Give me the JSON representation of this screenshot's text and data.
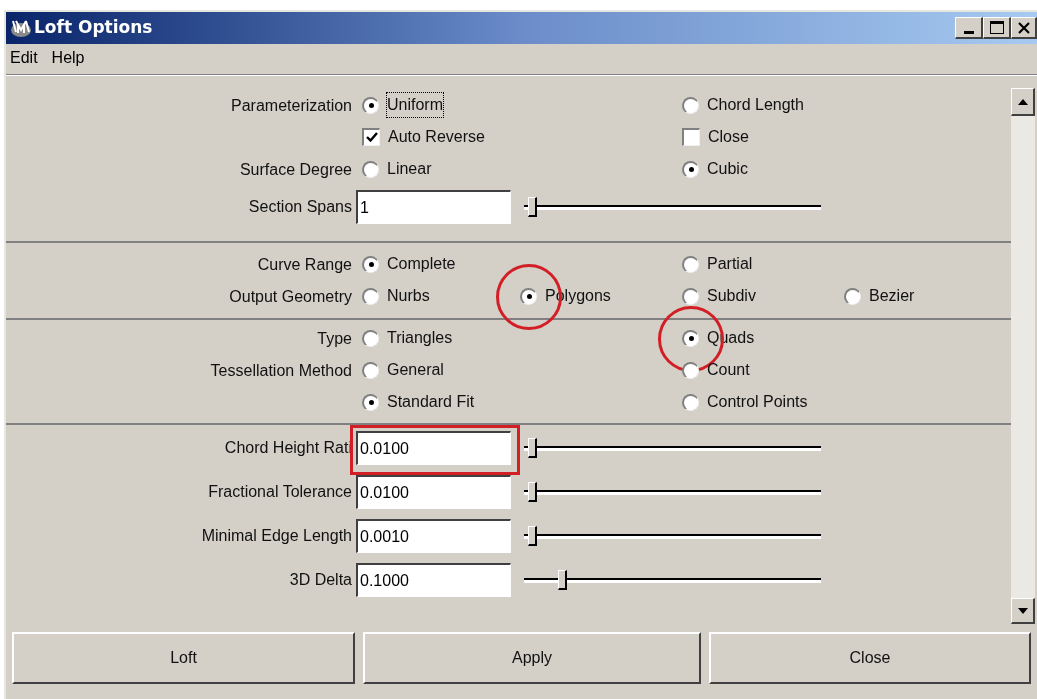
{
  "window": {
    "title": "Loft Options"
  },
  "menu": [
    "Edit",
    "Help"
  ],
  "sections": [
    {
      "rows": [
        {
          "kind": "radio",
          "label": "Parameterization",
          "options": [
            {
              "label": "Uniform",
              "selected": true,
              "focused": true,
              "circled": false
            },
            {
              "label": "Chord Length",
              "selected": false,
              "focused": false,
              "circled": false
            }
          ]
        },
        {
          "kind": "checkbox",
          "options": [
            {
              "label": "Auto Reverse",
              "checked": true
            },
            {
              "label": "Close",
              "checked": false
            }
          ]
        },
        {
          "kind": "radio",
          "label": "Surface Degree",
          "options": [
            {
              "label": "Linear",
              "selected": false,
              "focused": false,
              "circled": false
            },
            {
              "label": "Cubic",
              "selected": true,
              "focused": false,
              "circled": false
            }
          ]
        },
        {
          "kind": "slider",
          "label": "Section Spans",
          "value": "1",
          "level": 0.02,
          "boxed": false
        }
      ]
    },
    {
      "rows": [
        {
          "kind": "radio",
          "label": "Curve Range",
          "options": [
            {
              "label": "Complete",
              "selected": true,
              "focused": false,
              "circled": false
            },
            {
              "label": "Partial",
              "selected": false,
              "focused": false,
              "circled": false
            }
          ]
        },
        {
          "kind": "radio",
          "label": "Output Geometry",
          "options": [
            {
              "label": "Nurbs",
              "selected": false,
              "focused": false,
              "circled": false
            },
            {
              "label": "Polygons",
              "selected": true,
              "focused": false,
              "circled": true
            },
            {
              "label": "Subdiv",
              "selected": false,
              "focused": false,
              "circled": false
            },
            {
              "label": "Bezier",
              "selected": false,
              "focused": false,
              "circled": false
            }
          ]
        }
      ]
    },
    {
      "rows": [
        {
          "kind": "radio",
          "label": "Type",
          "options": [
            {
              "label": "Triangles",
              "selected": false,
              "focused": false,
              "circled": false
            },
            {
              "label": "Quads",
              "selected": true,
              "focused": false,
              "circled": true
            }
          ]
        },
        {
          "kind": "radio",
          "label": "Tessellation Method",
          "options": [
            {
              "label": "General",
              "selected": false,
              "focused": false,
              "circled": false
            },
            {
              "label": "Count",
              "selected": false,
              "focused": false,
              "circled": false
            }
          ]
        },
        {
          "kind": "radio",
          "options": [
            {
              "label": "Standard Fit",
              "selected": true,
              "focused": false,
              "circled": false
            },
            {
              "label": "Control Points",
              "selected": false,
              "focused": false,
              "circled": false
            }
          ]
        }
      ]
    },
    {
      "rows": [
        {
          "kind": "slider",
          "label": "Chord Height Rati",
          "value": "0.0100",
          "level": 0.02,
          "boxed": true
        },
        {
          "kind": "slider",
          "label": "Fractional Tolerance",
          "value": "0.0100",
          "level": 0.02,
          "boxed": false
        },
        {
          "kind": "slider",
          "label": "Minimal Edge Length",
          "value": "0.0010",
          "level": 0.02,
          "boxed": false
        },
        {
          "kind": "slider",
          "label": "3D Delta",
          "value": "0.1000",
          "level": 0.12,
          "boxed": false
        }
      ]
    }
  ],
  "buttons": [
    "Loft",
    "Apply",
    "Close"
  ]
}
